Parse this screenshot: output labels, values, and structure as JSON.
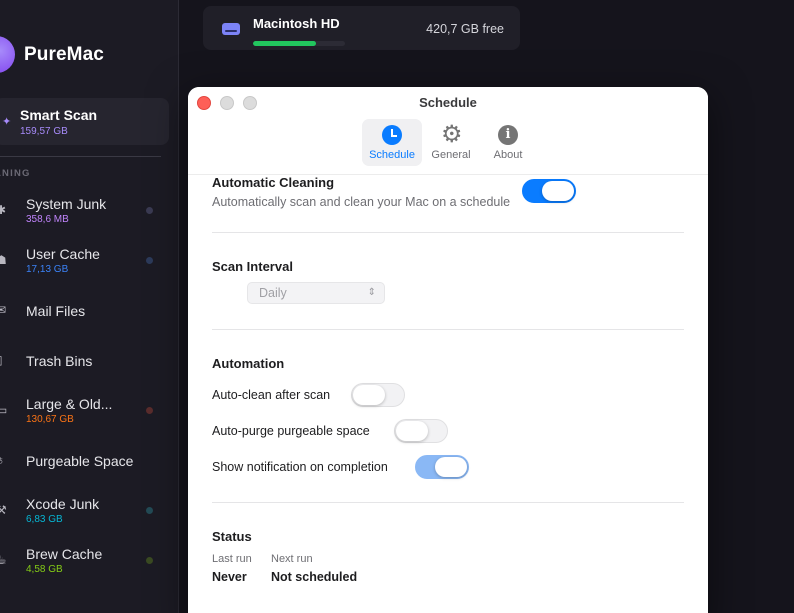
{
  "app": {
    "name": "PureMac"
  },
  "sidebar": {
    "smart_scan": {
      "label": "Smart Scan",
      "size": "159,57 GB",
      "size_color": "#a78bfa"
    },
    "section_label": "ANING",
    "items": [
      {
        "label": "System Junk",
        "size": "358,6 MB",
        "size_color": "#c084fc",
        "dot_color": "#3a3a52",
        "icon": "gear-icon"
      },
      {
        "label": "User Cache",
        "size": "17,13 GB",
        "size_color": "#3b82f6",
        "dot_color": "#2c3a5a",
        "icon": "cache-icon"
      },
      {
        "label": "Mail Files",
        "size": "",
        "size_color": "",
        "dot_color": "",
        "icon": "mail-icon"
      },
      {
        "label": "Trash Bins",
        "size": "",
        "size_color": "",
        "dot_color": "",
        "icon": "trash-icon"
      },
      {
        "label": "Large & Old...",
        "size": "130,67 GB",
        "size_color": "#f97316",
        "dot_color": "#5a2c2c",
        "icon": "document-icon"
      },
      {
        "label": "Purgeable Space",
        "size": "",
        "size_color": "",
        "dot_color": "",
        "icon": "purge-icon"
      },
      {
        "label": "Xcode Junk",
        "size": "6,83 GB",
        "size_color": "#06b6d4",
        "dot_color": "#234a55",
        "icon": "hammer-icon"
      },
      {
        "label": "Brew Cache",
        "size": "4,58 GB",
        "size_color": "#84cc16",
        "dot_color": "#3a4a22",
        "icon": "mug-icon"
      }
    ]
  },
  "disk": {
    "name": "Macintosh HD",
    "free": "420,7 GB free",
    "used_fraction": 0.68
  },
  "window": {
    "title": "Schedule",
    "tabs": [
      {
        "label": "Schedule",
        "icon": "clock-icon",
        "active": true
      },
      {
        "label": "General",
        "icon": "gear-icon",
        "active": false
      },
      {
        "label": "About",
        "icon": "info-icon",
        "active": false
      }
    ],
    "automatic_cleaning": {
      "title": "Automatic Cleaning",
      "description": "Automatically scan and clean your Mac on a schedule",
      "enabled": true
    },
    "scan_interval": {
      "title": "Scan Interval",
      "value": "Daily"
    },
    "automation": {
      "title": "Automation",
      "options": [
        {
          "label": "Auto-clean after scan",
          "enabled": false
        },
        {
          "label": "Auto-purge purgeable space",
          "enabled": false
        },
        {
          "label": "Show notification on completion",
          "enabled": true
        }
      ]
    },
    "status": {
      "title": "Status",
      "last_run_label": "Last run",
      "last_run_value": "Never",
      "next_run_label": "Next run",
      "next_run_value": "Not scheduled"
    }
  }
}
